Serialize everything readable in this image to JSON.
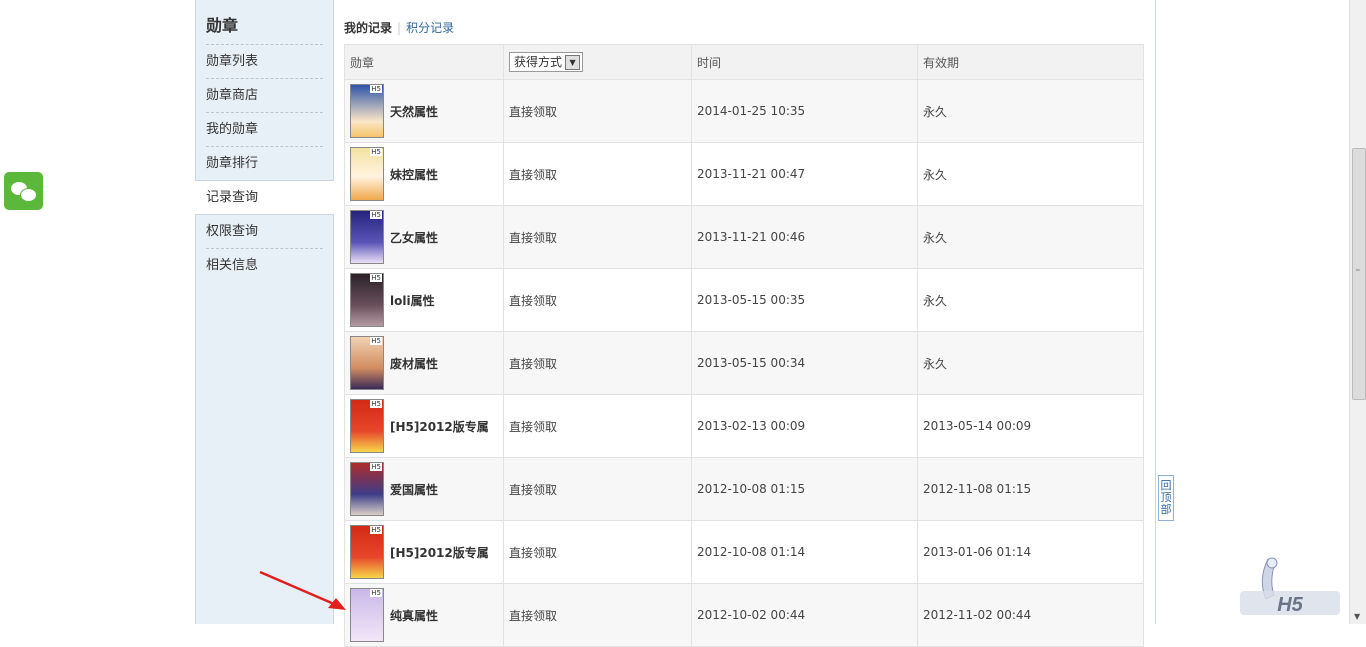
{
  "sidebar": {
    "title": "勋章",
    "items": [
      {
        "label": "勋章列表"
      },
      {
        "label": "勋章商店"
      },
      {
        "label": "我的勋章"
      },
      {
        "label": "勋章排行"
      },
      {
        "label": "记录查询"
      },
      {
        "label": "权限查询"
      },
      {
        "label": "相关信息"
      }
    ],
    "active_index": 4
  },
  "tabs": {
    "active": "我的记录",
    "other": "积分记录"
  },
  "table": {
    "headers": {
      "medal": "勋章",
      "method_select": "获得方式",
      "time": "时间",
      "validity": "有效期"
    },
    "rows": [
      {
        "name": "天然属性",
        "method": "直接领取",
        "time": "2014-01-25 10:35",
        "validity": "永久"
      },
      {
        "name": "妹控属性",
        "method": "直接领取",
        "time": "2013-11-21 00:47",
        "validity": "永久"
      },
      {
        "name": "乙女属性",
        "method": "直接领取",
        "time": "2013-11-21 00:46",
        "validity": "永久"
      },
      {
        "name": "loli属性",
        "method": "直接领取",
        "time": "2013-05-15 00:35",
        "validity": "永久"
      },
      {
        "name": "废材属性",
        "method": "直接领取",
        "time": "2013-05-15 00:34",
        "validity": "永久"
      },
      {
        "name": "[H5]2012版专属",
        "method": "直接领取",
        "time": "2013-02-13 00:09",
        "validity": "2013-05-14 00:09"
      },
      {
        "name": "爱国属性",
        "method": "直接领取",
        "time": "2012-10-08 01:15",
        "validity": "2012-11-08 01:15"
      },
      {
        "name": "[H5]2012版专属",
        "method": "直接领取",
        "time": "2012-10-08 01:14",
        "validity": "2013-01-06 01:14"
      },
      {
        "name": "纯真属性",
        "method": "直接领取",
        "time": "2012-10-02 00:44",
        "validity": "2012-11-02 00:44"
      }
    ],
    "medal_tag": "H5"
  },
  "back_to_top": "回顶部",
  "colors": {
    "accent": "#336699",
    "sidebar_bg": "#e8f0f7",
    "wechat": "#5bb83b",
    "annotation_arrow": "#e02020"
  }
}
